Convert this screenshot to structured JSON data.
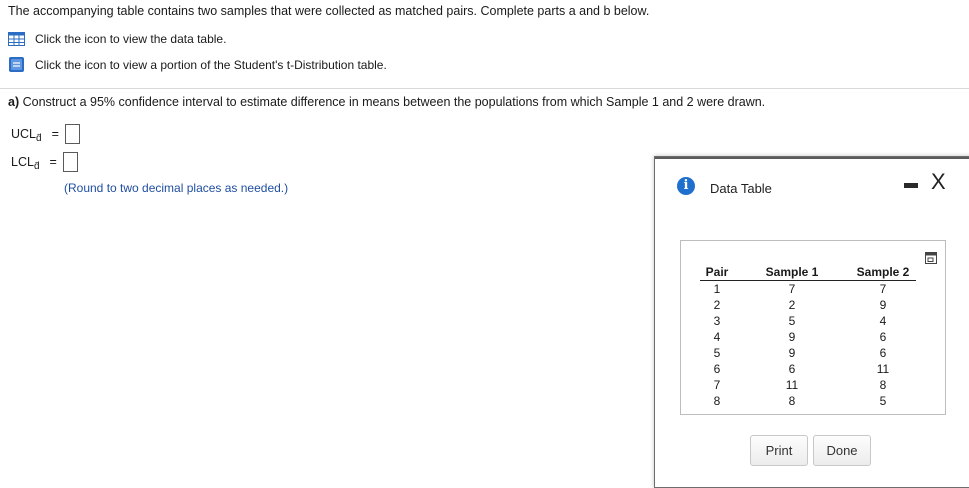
{
  "intro": "The accompanying table contains two samples that were collected as matched pairs. Complete parts a and b below.",
  "links": {
    "data_table": "Click the icon to view the data table.",
    "t_table": "Click the icon to view a portion of the Student's t-Distribution table."
  },
  "part_a": {
    "label": "a)",
    "text": "Construct a 95% confidence interval to estimate difference in means between the populations from which Sample 1 and 2 were drawn."
  },
  "ucl": {
    "label": "UCL",
    "sub": "d̄",
    "eq": "="
  },
  "lcl": {
    "label": "LCL",
    "sub": "d̄",
    "eq": "="
  },
  "round_note": "(Round to two decimal places as needed.)",
  "dialog": {
    "info_glyph": "i",
    "title": "Data Table",
    "close_glyph": "X",
    "columns": [
      "Pair",
      "Sample 1",
      "Sample 2"
    ],
    "rows": [
      [
        "1",
        "7",
        "7"
      ],
      [
        "2",
        "2",
        "9"
      ],
      [
        "3",
        "5",
        "4"
      ],
      [
        "4",
        "9",
        "6"
      ],
      [
        "5",
        "9",
        "6"
      ],
      [
        "6",
        "6",
        "11"
      ],
      [
        "7",
        "11",
        "8"
      ],
      [
        "8",
        "8",
        "5"
      ]
    ],
    "print_label": "Print",
    "done_label": "Done"
  },
  "colors": {
    "accent_blue": "#1f6fce",
    "note_blue": "#1f4fa0"
  }
}
